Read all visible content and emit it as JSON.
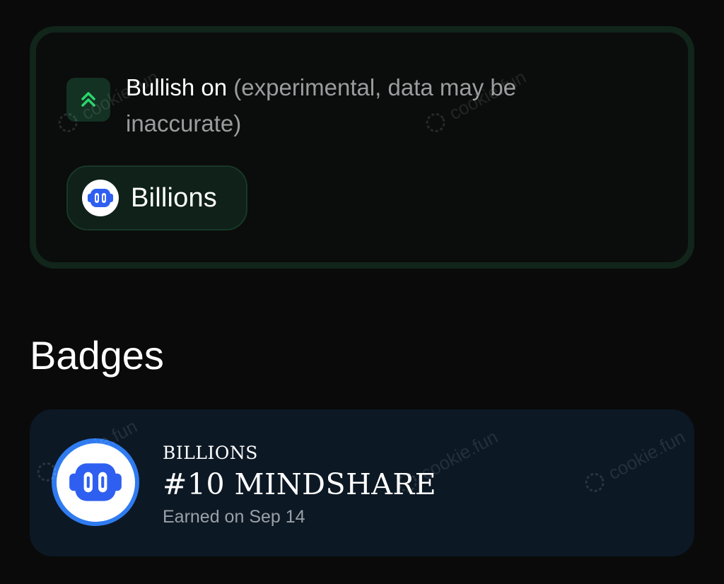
{
  "bullish": {
    "title": "Bullish on",
    "note": "(experimental, data may be inaccurate)",
    "icon": "double-chevron-up-icon",
    "token": {
      "name": "Billions",
      "icon": "billions-logo-icon"
    }
  },
  "badges": {
    "heading": "Badges",
    "items": [
      {
        "project": "BILLIONS",
        "title": "#10 MINDSHARE",
        "earned": "Earned on Sep 14",
        "icon": "billions-logo-icon"
      }
    ]
  },
  "watermark": "cookie.fun",
  "colors": {
    "background": "#0a0a0b",
    "bullish_border": "#11251a",
    "bullish_icon_bg": "#133223",
    "bullish_accent": "#2bd46a",
    "chip_bg": "#0f2118",
    "badge_card_bg": "#0c1824",
    "billions_blue": "#2f5ff0"
  }
}
